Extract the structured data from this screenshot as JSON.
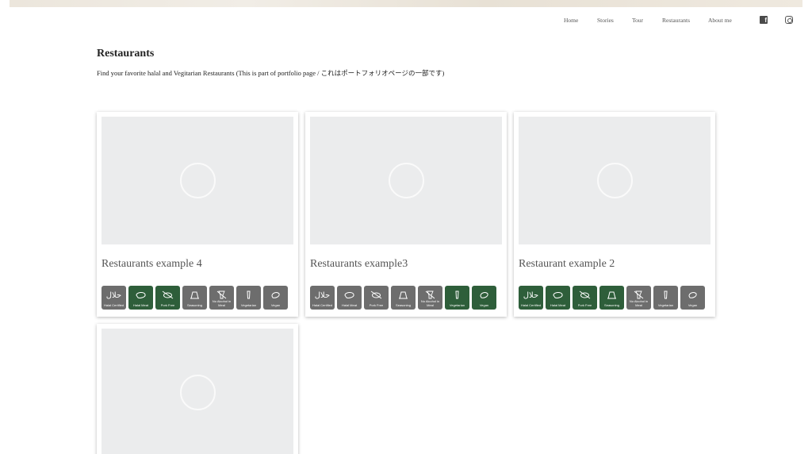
{
  "nav": {
    "items": [
      "Home",
      "Stories",
      "Tour",
      "Restaurants",
      "About me"
    ],
    "social": [
      "facebook-icon",
      "instagram-icon"
    ]
  },
  "page": {
    "title": "Restaurants",
    "description": "Find your favorite halal and Vegitarian Restaurants (This is part of portfolio page / これはポートフォリオページの一部です)"
  },
  "badge_labels": [
    "Halal Certified",
    "Halal Meat",
    "Pork Free",
    "Seasoning",
    "No Alcohol in Meal",
    "Vegetarian",
    "Vegan"
  ],
  "badge_icons": [
    "halal-arabic-icon",
    "meat-icon",
    "no-pork-icon",
    "seasoning-icon",
    "no-alcohol-icon",
    "vegetarian-icon",
    "vegan-icon"
  ],
  "colors": {
    "badge_active": "#2e5e3a",
    "badge_inactive": "#6d6d6d",
    "image_placeholder": "#ebeced"
  },
  "restaurants": [
    {
      "title": "Restaurants example 4",
      "badges_active": [
        false,
        true,
        true,
        false,
        false,
        false,
        false
      ]
    },
    {
      "title": "Restaurants example3",
      "badges_active": [
        false,
        false,
        false,
        false,
        false,
        true,
        true
      ]
    },
    {
      "title": "Restaurant example 2",
      "badges_active": [
        true,
        true,
        true,
        true,
        false,
        false,
        false
      ]
    },
    {
      "title": "",
      "badges_active": []
    }
  ]
}
